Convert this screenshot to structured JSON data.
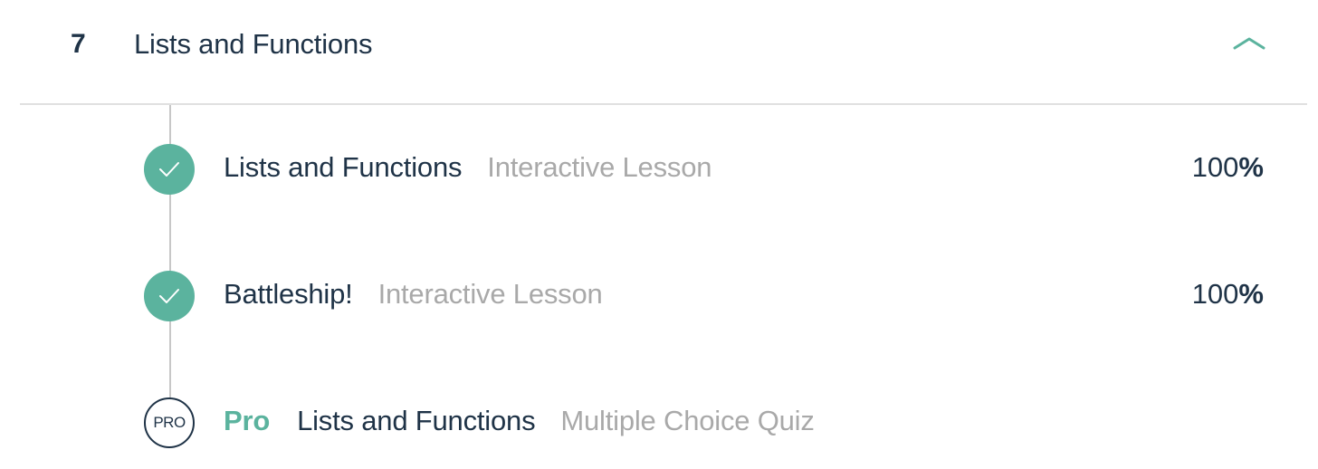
{
  "unit": {
    "number": "7",
    "title": "Lists and Functions",
    "expanded": true,
    "toggle_icon": "chevron-up-icon"
  },
  "accent_color": "#5bb39e",
  "items": [
    {
      "title": "Lists and Functions",
      "type": "Interactive Lesson",
      "status_icon": "check-icon",
      "progress_value": "100",
      "progress_unit": "%"
    },
    {
      "title": "Battleship!",
      "type": "Interactive Lesson",
      "status_icon": "check-icon",
      "progress_value": "100",
      "progress_unit": "%"
    },
    {
      "badge": "PRO",
      "pro_label": "Pro",
      "title": "Lists and Functions",
      "type": "Multiple Choice Quiz",
      "status_icon": "pro-badge-icon"
    }
  ]
}
